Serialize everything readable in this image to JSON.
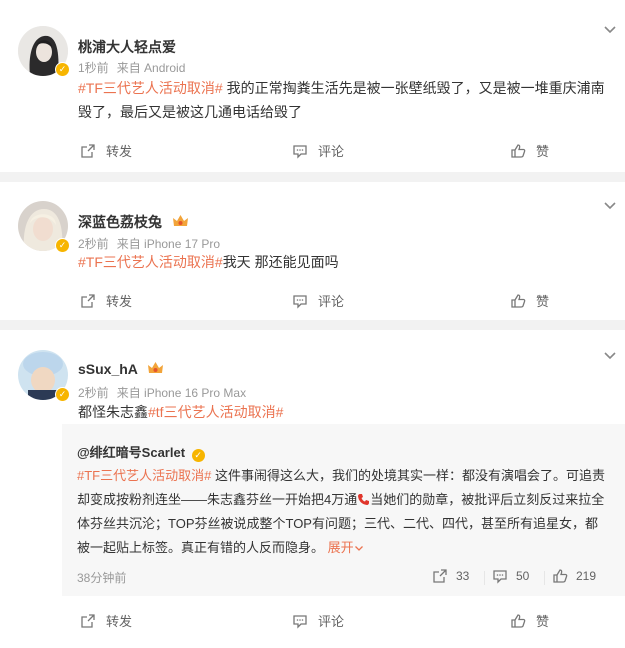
{
  "posts": [
    {
      "user": "桃浦大人轻点爱",
      "time": "1秒前",
      "source": "来自 Android",
      "topic": "#TF三代艺人活动取消#",
      "text_line1": " 我的正常掏粪生活先是被一张壁纸毁了，又是被一堆重庆浦南",
      "text_line2": "毁了，最后又是被这几通电话给毁了",
      "repost_label": "转发",
      "comment_label": "评论",
      "like_label": "赞"
    },
    {
      "user": "深蓝色荔枝兔",
      "time": "2秒前",
      "source": "来自 iPhone 17 Pro",
      "topic": "#TF三代艺人活动取消#",
      "text": "我天 那还能见面吗",
      "repost_label": "转发",
      "comment_label": "评论",
      "like_label": "赞"
    },
    {
      "user": "sSux_hA",
      "time": "2秒前",
      "source": "来自 iPhone 16 Pro Max",
      "text_prefix": "都怪朱志鑫",
      "topic": "#tf三代艺人活动取消#",
      "repost_label": "转发",
      "comment_label": "评论",
      "like_label": "赞",
      "quoted": {
        "user": "@绯红暗号Scarlet",
        "topic": "#TF三代艺人活动取消#",
        "text_a": " 这件事闹得这么大，我们的处境其实一样：都没有演唱会了。可追责却变成按粉剂连坐——朱志鑫芬丝一开始把4万通",
        "text_b": "当她们的勋章，被批评后立刻反过来拉全体芬丝共沉沦；TOP芬丝被说成整个TOP有问题；三代、二代、四代，甚至所有追星女，都被一起贴上标签。真正有错的人反而隐身。",
        "expand_label": "展开",
        "time": "38分钟前",
        "repost_count": "33",
        "comment_count": "50",
        "like_count": "219"
      }
    }
  ],
  "colors": {
    "topic": "#eb7350",
    "badge": "#f7b500"
  }
}
